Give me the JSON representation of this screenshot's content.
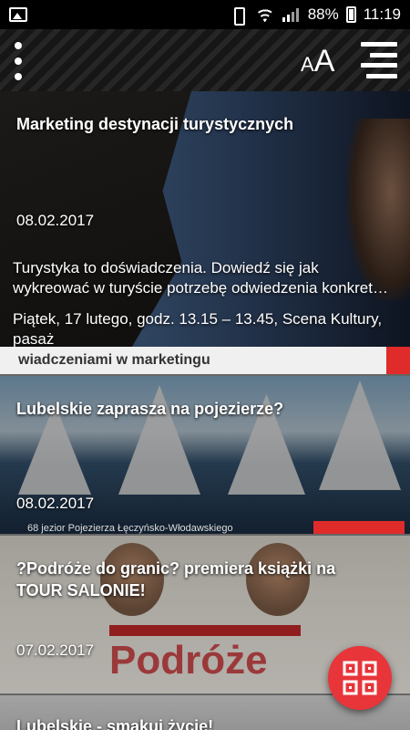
{
  "status_bar": {
    "battery": "88%",
    "time": "11:19",
    "icons": [
      "gallery-icon",
      "vibrate-icon",
      "wifi-icon",
      "signal-icon",
      "battery-icon"
    ]
  },
  "toolbar": {
    "font_size_label": "AA",
    "icons": [
      "more-vert-icon",
      "font-size-icon",
      "menu-icon"
    ]
  },
  "articles": [
    {
      "title": "Marketing destynacji turystycznych",
      "date": "08.02.2017",
      "excerpt_1": "Turystyka to doświadczenia. Dowiedź się jak wykreować w turyście potrzebę odwiedzenia konkret…",
      "excerpt_2": "Piątek, 17 lutego, godz. 13.15 – 13.45, Scena Kultury, pasaż",
      "excerpt_3": "...",
      "image_banner": "wiadczeniami w marketingu"
    },
    {
      "title": "Lubelskie zaprasza na pojezierze?",
      "date": "08.02.2017",
      "image_caption": "68 jezior Pojezierza Łęczyńsko-Włodawskiego"
    },
    {
      "title": "?Podróże do granic? premiera książki na TOUR SALONIE!",
      "date": "07.02.2017",
      "image_text": "Podróże"
    },
    {
      "title": "Lubelskie - smakuj życie!"
    }
  ],
  "fab": {
    "icon": "qr-code-icon"
  },
  "colors": {
    "accent": "#e8353a",
    "statusbar": "#000000"
  }
}
